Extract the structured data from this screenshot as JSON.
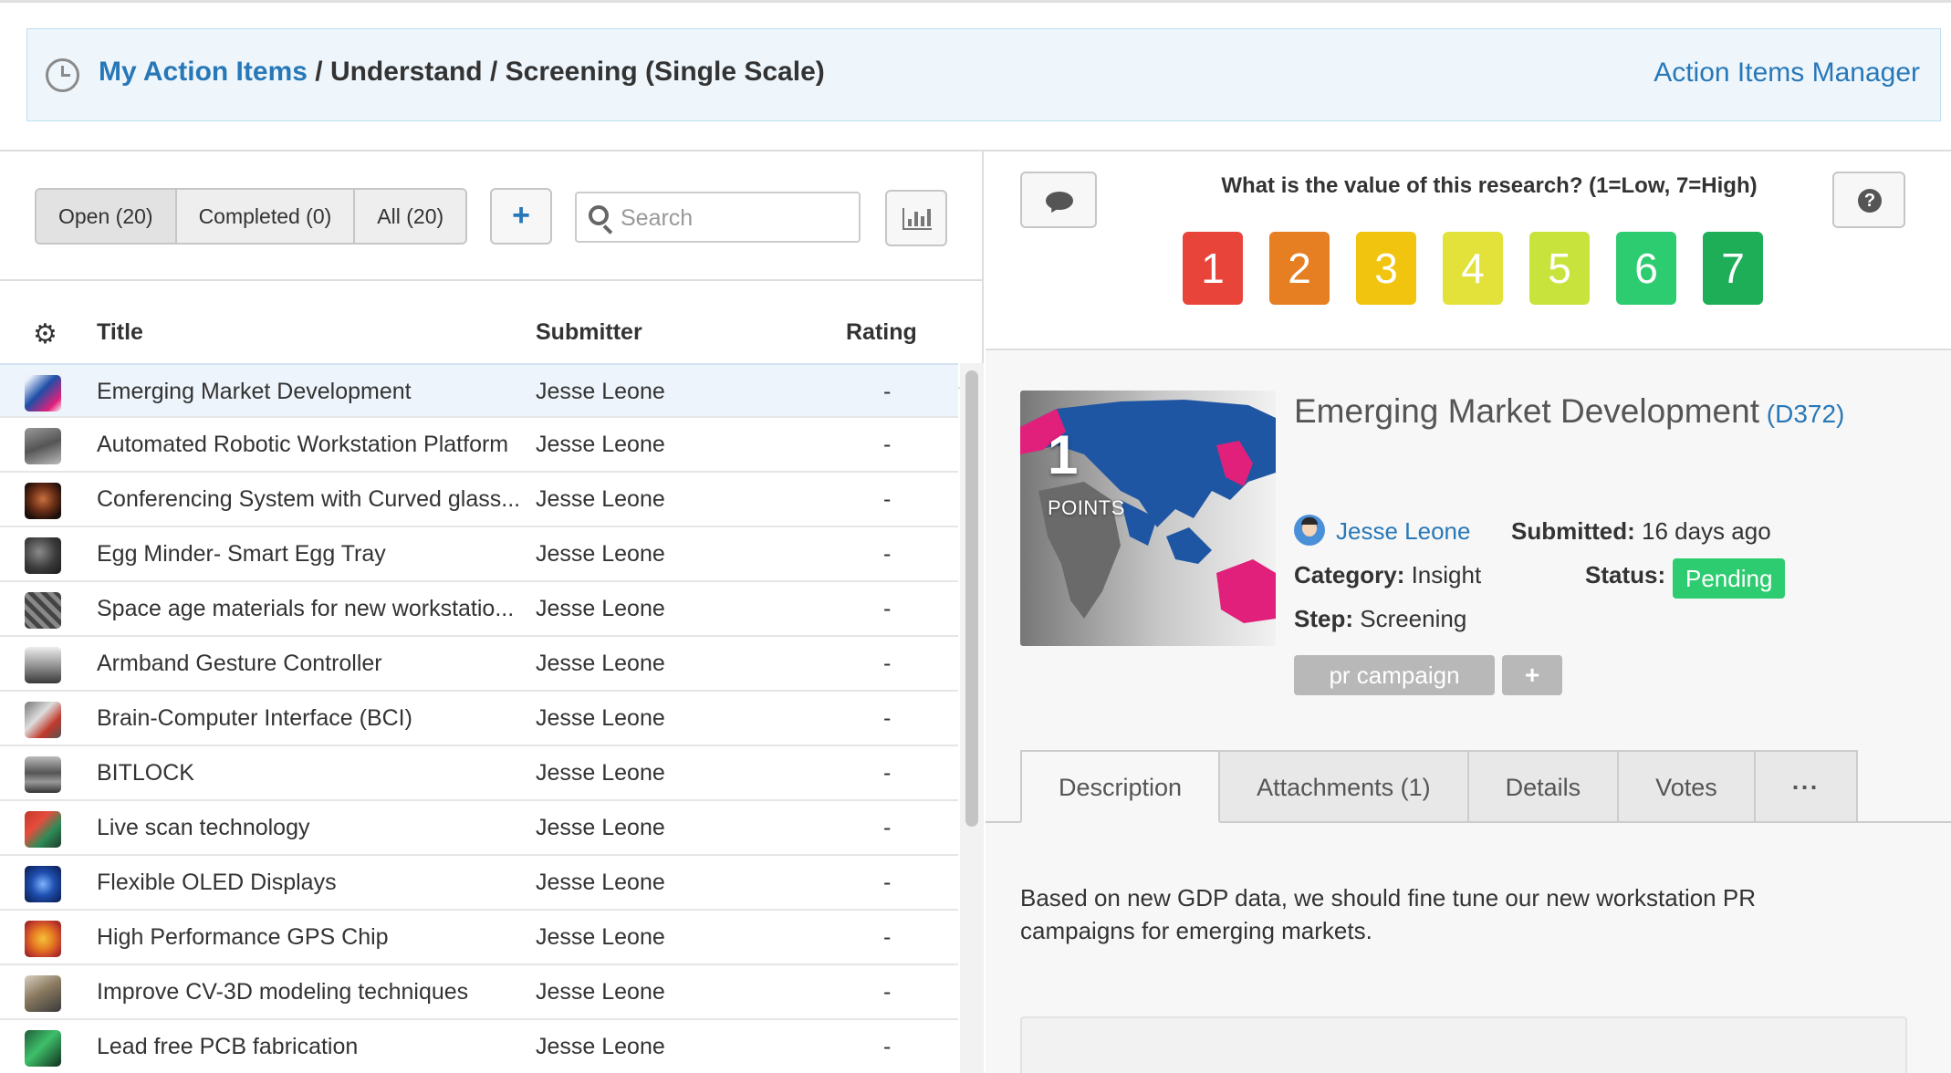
{
  "header": {
    "breadcrumb_link": "My Action Items",
    "breadcrumb_rest": " / Understand / Screening (Single Scale)",
    "manager_link": "Action Items Manager"
  },
  "filters": {
    "open": "Open (20)",
    "completed": "Completed (0)",
    "all": "All (20)",
    "add": "+",
    "search_placeholder": "Search"
  },
  "table": {
    "columns": [
      "Title",
      "Submitter",
      "Rating"
    ],
    "rows": [
      {
        "title": "Emerging Market Development",
        "submitter": "Jesse Leone",
        "rating": "-"
      },
      {
        "title": "Automated Robotic Workstation Platform",
        "submitter": "Jesse Leone",
        "rating": "-"
      },
      {
        "title": "Conferencing System with Curved glass...",
        "submitter": "Jesse Leone",
        "rating": "-"
      },
      {
        "title": "Egg Minder- Smart Egg Tray",
        "submitter": "Jesse Leone",
        "rating": "-"
      },
      {
        "title": "Space age materials for new workstatio...",
        "submitter": "Jesse Leone",
        "rating": "-"
      },
      {
        "title": "Armband Gesture Controller",
        "submitter": "Jesse Leone",
        "rating": "-"
      },
      {
        "title": "Brain-Computer Interface (BCI)",
        "submitter": "Jesse Leone",
        "rating": "-"
      },
      {
        "title": "BITLOCK",
        "submitter": "Jesse Leone",
        "rating": "-"
      },
      {
        "title": "Live scan technology",
        "submitter": "Jesse Leone",
        "rating": "-"
      },
      {
        "title": "Flexible OLED Displays",
        "submitter": "Jesse Leone",
        "rating": "-"
      },
      {
        "title": "High Performance GPS Chip",
        "submitter": "Jesse Leone",
        "rating": "-"
      },
      {
        "title": "Improve CV-3D modeling techniques",
        "submitter": "Jesse Leone",
        "rating": "-"
      },
      {
        "title": "Lead free PCB fabrication",
        "submitter": "Jesse Leone",
        "rating": "-"
      }
    ]
  },
  "rating": {
    "question": "What is the value of this research? (1=Low, 7=High)",
    "scores": [
      {
        "label": "1",
        "color": "#e8443a"
      },
      {
        "label": "2",
        "color": "#e67e22"
      },
      {
        "label": "3",
        "color": "#f1c40f"
      },
      {
        "label": "4",
        "color": "#e2e23a"
      },
      {
        "label": "5",
        "color": "#c9e33d"
      },
      {
        "label": "6",
        "color": "#2ecc71"
      },
      {
        "label": "7",
        "color": "#1fae58"
      }
    ]
  },
  "detail": {
    "points": "1",
    "points_label": "POINTS",
    "title": "Emerging Market Development",
    "code_open": " (",
    "code": "D372",
    "code_close": ")",
    "author": "Jesse Leone",
    "submitted_label": "Submitted:",
    "submitted_value": " 16 days ago",
    "category_label": "Category:",
    "category_value": " Insight",
    "status_label": "Status:",
    "status_value": "Pending",
    "step_label": "Step:",
    "step_value": " Screening",
    "tag": "pr campaign",
    "tag_add": "+",
    "tabs": [
      "Description",
      "Attachments (1)",
      "Details",
      "Votes",
      "···"
    ],
    "description": "Based on new GDP data, we should fine tune our new workstation PR campaigns for emerging markets."
  }
}
